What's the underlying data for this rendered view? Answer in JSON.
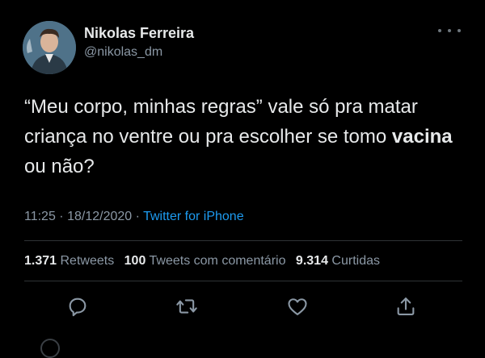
{
  "user": {
    "display_name": "Nikolas Ferreira",
    "handle": "@nikolas_dm"
  },
  "tweet": {
    "text_before_bold": "“Meu corpo, minhas regras” vale só pra matar criança no ventre ou pra escolher se tomo ",
    "text_bold": "vacina",
    "text_after_bold": " ou não?",
    "time": "11:25",
    "separator": " · ",
    "date": "18/12/2020",
    "source_separator": " · ",
    "source": "Twitter for iPhone"
  },
  "stats": {
    "retweets_count": "1.371",
    "retweets_label": "Retweets",
    "quotes_count": "100",
    "quotes_label": "Tweets com comentário",
    "likes_count": "9.314",
    "likes_label": "Curtidas"
  },
  "icons": {
    "more": "more-horizontal-icon",
    "reply": "reply-icon",
    "retweet": "retweet-icon",
    "like": "heart-icon",
    "share": "share-icon"
  },
  "colors": {
    "background": "#000000",
    "text": "#e7e9ea",
    "secondary": "#8b98a5",
    "link": "#1d9bf0",
    "divider": "#2f3336"
  }
}
